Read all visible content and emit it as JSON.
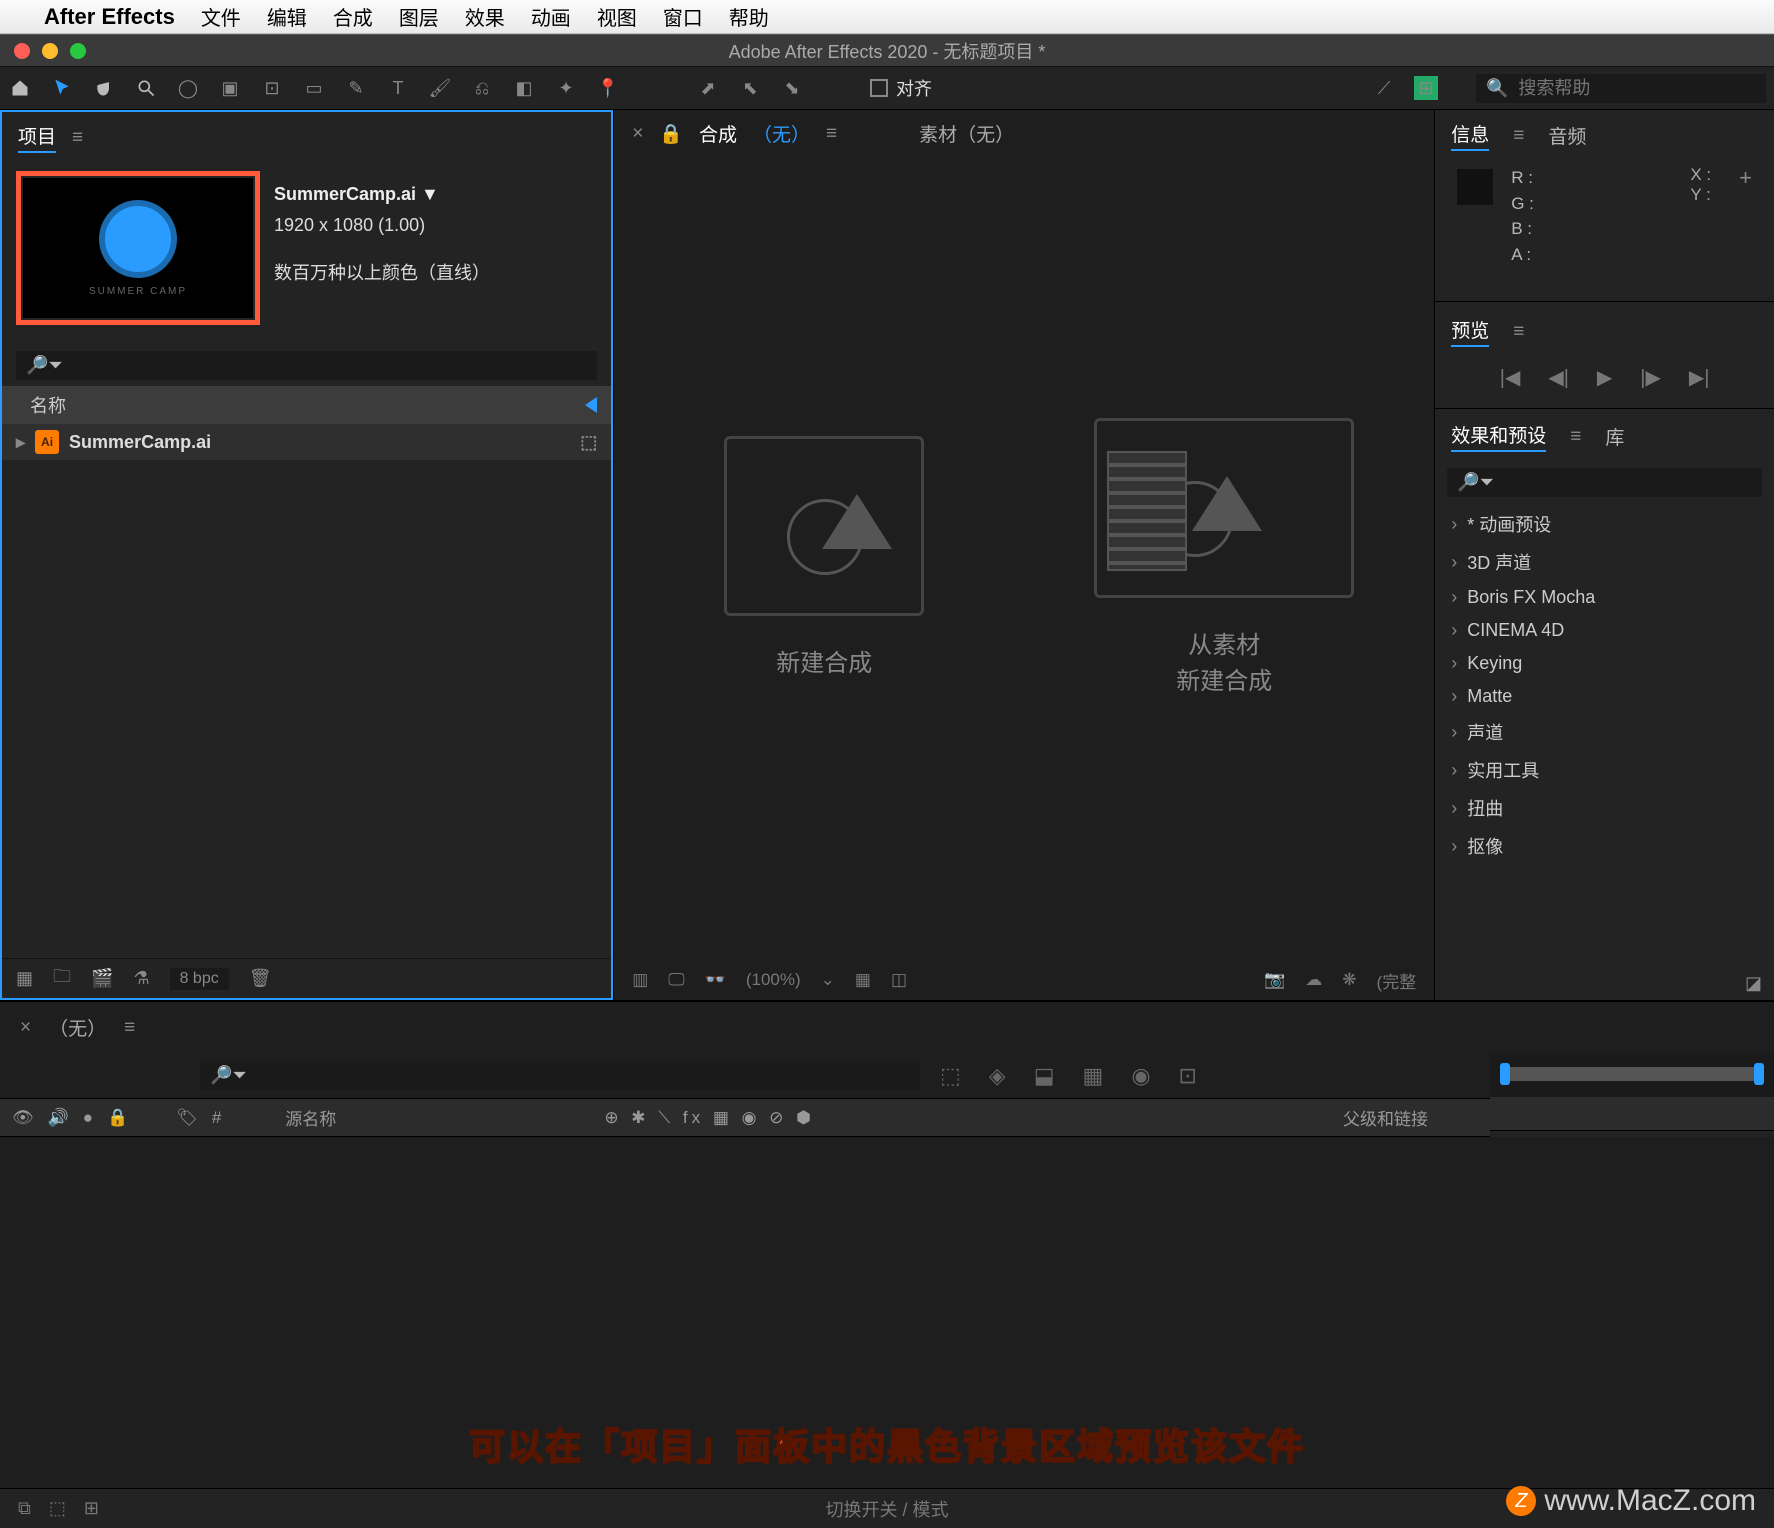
{
  "mac_menu": {
    "app": "After Effects",
    "items": [
      "文件",
      "编辑",
      "合成",
      "图层",
      "效果",
      "动画",
      "视图",
      "窗口",
      "帮助"
    ]
  },
  "window": {
    "title": "Adobe After Effects 2020 - 无标题项目 *"
  },
  "toolbar": {
    "snap": "对齐",
    "search_placeholder": "搜索帮助"
  },
  "project": {
    "tab": "项目",
    "asset_name": "SummerCamp.ai ▼",
    "asset_dims": "1920 x 1080 (1.00)",
    "asset_colors": "数百万种以上颜色（直线）",
    "thumb_label": "SUMMER CAMP",
    "col_name": "名称",
    "row_file": "SummerCamp.ai",
    "bpc": "8 bpc"
  },
  "center": {
    "comp_label": "合成",
    "none": "（无）",
    "footage_label": "素材（无）",
    "card1": "新建合成",
    "card2_line1": "从素材",
    "card2_line2": "新建合成",
    "zoom": "(100%)",
    "status": "(完整"
  },
  "info": {
    "tab1": "信息",
    "tab2": "音频",
    "R": "R :",
    "G": "G :",
    "B": "B :",
    "A": "A :",
    "X": "X :",
    "Y": "Y :"
  },
  "preview": {
    "tab": "预览"
  },
  "fx": {
    "tab1": "效果和预设",
    "tab2": "库",
    "items": [
      "* 动画预设",
      "3D 声道",
      "Boris FX Mocha",
      "CINEMA 4D",
      "Keying",
      "Matte",
      "声道",
      "实用工具",
      "扭曲",
      "抠像"
    ]
  },
  "timeline": {
    "none": "（无）",
    "src": "源名称",
    "parent": "父级和链接",
    "hash": "#",
    "switch_mode": "切换开关 / 模式"
  },
  "caption": "可以在「项目」面板中的黑色背景区域预览该文件",
  "watermark": "www.MacZ.com"
}
